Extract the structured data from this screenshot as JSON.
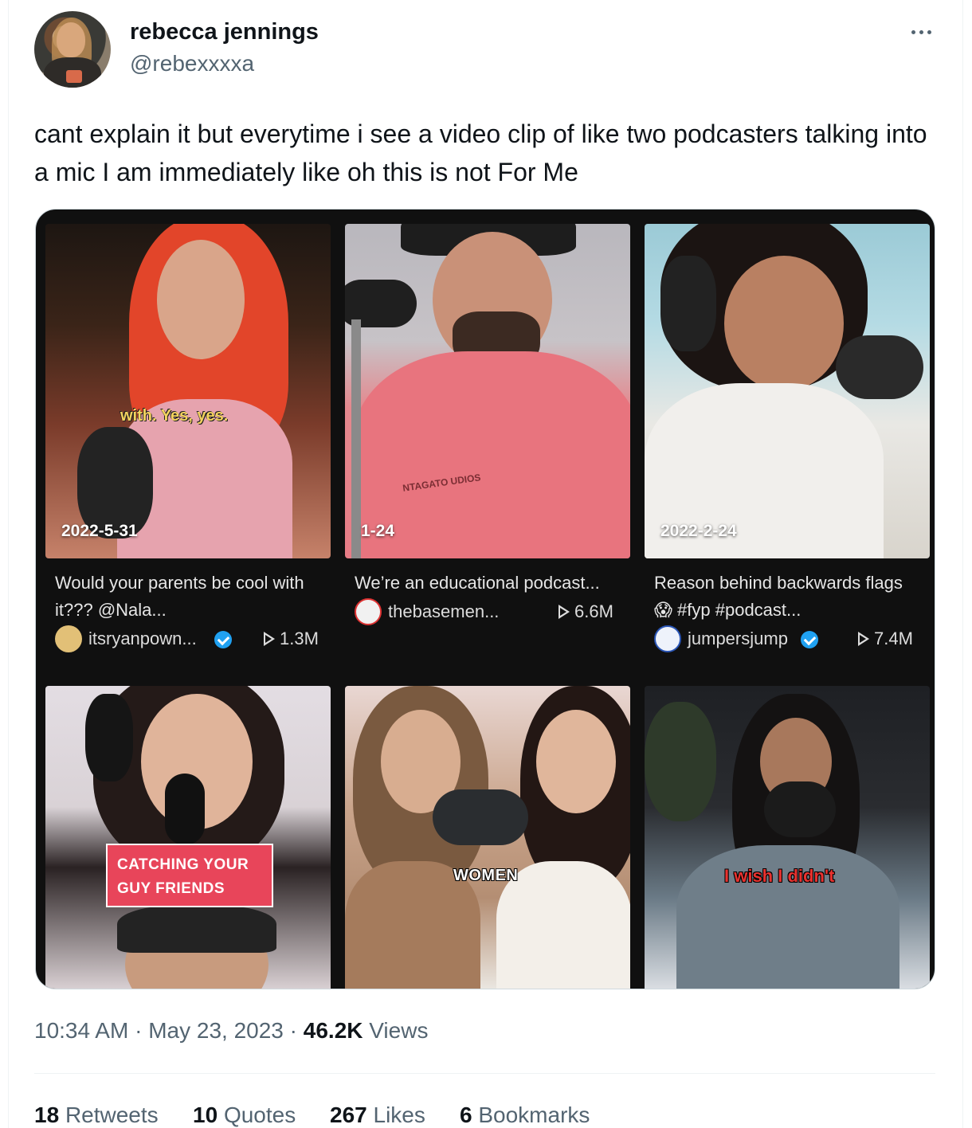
{
  "tweet": {
    "author": {
      "display_name": "rebecca jennings",
      "handle": "@rebexxxxa"
    },
    "text": "cant explain it but everytime i see a video clip of like two podcasters talking into a mic I am immediately like oh this is not For Me",
    "time": "10:34 AM",
    "separator": "·",
    "date": "May 23, 2023",
    "views_count": "46.2K",
    "views_label": "Views"
  },
  "media": {
    "videos": [
      {
        "date": "2022-5-31",
        "overlay_caption": "with. Yes, yes.",
        "title": "Would your parents be cool with it??? @Nala...",
        "username": "itsryanpown...",
        "verified": true,
        "views": "1.3M"
      },
      {
        "date": "1-24",
        "overlay_caption": "NTAGATO UDIOS",
        "title": "We’re an educational podcast...",
        "username": "thebasemen...",
        "verified": false,
        "views": "6.6M"
      },
      {
        "date": "2022-2-24",
        "overlay_caption": "",
        "title": "Reason behind backwards flags 😱 #fyp #podcast...",
        "username": "jumpersjump",
        "verified": true,
        "views": "7.4M"
      },
      {
        "sticker_line1": "CATCHING YOUR",
        "sticker_line2": "GUY FRIENDS"
      },
      {
        "overlay_caption": "WOMEN"
      },
      {
        "overlay_caption": "I wish I didn't"
      }
    ]
  },
  "stats": [
    {
      "count": "18",
      "label": "Retweets"
    },
    {
      "count": "10",
      "label": "Quotes"
    },
    {
      "count": "267",
      "label": "Likes"
    },
    {
      "count": "6",
      "label": "Bookmarks"
    }
  ],
  "colors": {
    "text": "#0f1419",
    "secondary": "#536471",
    "verified": "#20a1f1",
    "media_bg": "#101010",
    "sticker": "#e8455a"
  },
  "icons": [
    "more-icon",
    "play-icon",
    "verified-icon"
  ]
}
